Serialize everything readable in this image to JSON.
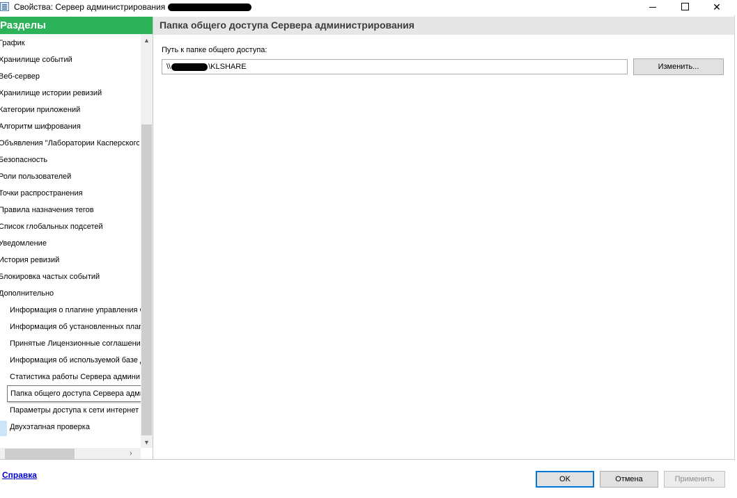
{
  "window": {
    "title": "Свойства: Сервер администрирования",
    "minimize_glyph": "",
    "maximize_glyph": "",
    "close_glyph": "✕"
  },
  "sidebar": {
    "header": "Разделы",
    "items": [
      {
        "label": "График",
        "sub": false
      },
      {
        "label": "Хранилище событий",
        "sub": false
      },
      {
        "label": "Веб-сервер",
        "sub": false
      },
      {
        "label": "Хранилище истории ревизий",
        "sub": false
      },
      {
        "label": "Категории приложений",
        "sub": false
      },
      {
        "label": "Алгоритм шифрования",
        "sub": false
      },
      {
        "label": "Объявления \"Лаборатории Касперского\"",
        "sub": false
      },
      {
        "label": "Безопасность",
        "sub": false
      },
      {
        "label": "Роли пользователей",
        "sub": false
      },
      {
        "label": "Точки распространения",
        "sub": false
      },
      {
        "label": "Правила назначения тегов",
        "sub": false
      },
      {
        "label": "Список глобальных подсетей",
        "sub": false
      },
      {
        "label": "Уведомление",
        "sub": false
      },
      {
        "label": "История ревизий",
        "sub": false
      },
      {
        "label": "Блокировка частых событий",
        "sub": false
      },
      {
        "label": "Дополнительно",
        "sub": false
      },
      {
        "label": "Информация о плагине управления С",
        "sub": true
      },
      {
        "label": "Информация об установленных плаги",
        "sub": true
      },
      {
        "label": "Принятые Лицензионные соглашения",
        "sub": true
      },
      {
        "label": "Информация об используемой базе д",
        "sub": true
      },
      {
        "label": "Статистика работы Сервера админи",
        "sub": true
      },
      {
        "label": "",
        "sub": true
      },
      {
        "label": "Параметры доступа к сети интернет",
        "sub": true
      },
      {
        "label": "Двухэтапная проверка",
        "sub": true
      }
    ],
    "tooltip": "Папка общего доступа Сервера администрирования",
    "scroll_up": "▲",
    "scroll_down": "▼",
    "scroll_right": "›"
  },
  "content": {
    "title": "Папка общего доступа Сервера администрирования",
    "path_label": "Путь к папке общего доступа:",
    "path_prefix": "\\\\",
    "path_suffix": "\\KLSHARE",
    "change_button": "Изменить..."
  },
  "footer": {
    "help_link": "Справка",
    "ok": "OK",
    "cancel": "Отмена",
    "apply": "Применить"
  }
}
